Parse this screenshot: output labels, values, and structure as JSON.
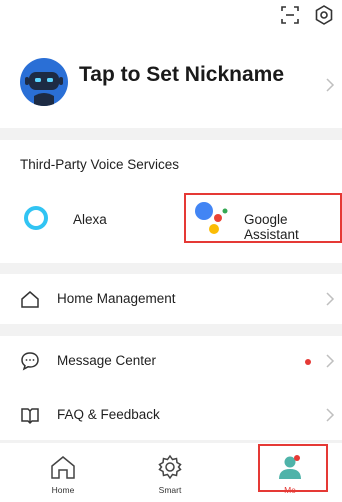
{
  "topbar": {
    "scan_icon": "scan-icon",
    "settings_icon": "settings-icon"
  },
  "profile": {
    "nickname_prompt": "Tap to Set Nickname",
    "avatar_icon": "robot-avatar-icon"
  },
  "voice_services": {
    "title": "Third-Party Voice Services",
    "items": [
      {
        "label": "Alexa",
        "icon": "alexa-icon"
      },
      {
        "label": "Google Assistant",
        "icon": "google-assistant-icon"
      }
    ]
  },
  "menu": {
    "home_management": "Home Management",
    "message_center": "Message Center",
    "faq_feedback": "FAQ & Feedback"
  },
  "tabbar": {
    "tabs": [
      {
        "label": "Home",
        "icon": "home-icon"
      },
      {
        "label": "Smart",
        "icon": "smart-icon"
      },
      {
        "label": "Me",
        "icon": "me-icon"
      }
    ],
    "active": "Me"
  },
  "colors": {
    "accent": "#e53935",
    "avatar_blue": "#2a6fd6",
    "me_teal": "#4fb3a9",
    "alexa_blue": "#31c4f3"
  }
}
